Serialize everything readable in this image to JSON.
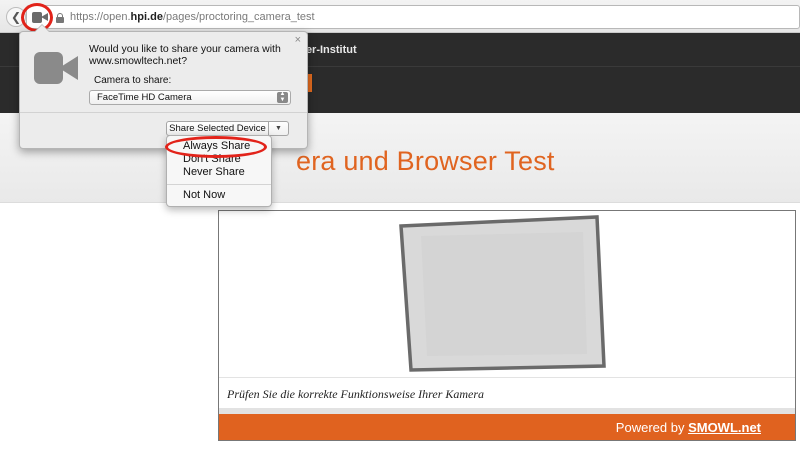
{
  "browser": {
    "back_glyph": "❮",
    "url_prefix": "https://open.",
    "url_domain": "hpi.de",
    "url_path": "/pages/proctoring_camera_test",
    "camera_icon": "camera-icon",
    "lock_icon": "lock-icon"
  },
  "site": {
    "name_fragment": "o-Plattner-Institut",
    "heading_fragment": "era und Browser Test",
    "accent_color": "#e06420"
  },
  "permission_popover": {
    "prompt": "Would you like to share your camera with www.smowltech.net?",
    "camera_label": "Camera to share:",
    "camera_selected": "FaceTime HD Camera",
    "share_button_label": "Share Selected Device",
    "close_glyph": "×",
    "dropdown_glyph": "▼",
    "stepper_up": "▲",
    "stepper_down": "▼"
  },
  "share_menu": {
    "items": [
      "Always Share",
      "Don't Share",
      "Never Share",
      "Not Now"
    ]
  },
  "camera_test": {
    "caption": "Prüfen Sie die korrekte Funktionsweise Ihrer Kamera",
    "powered_text": "Powered by ",
    "powered_link": "SMOWL.net"
  },
  "annotations": {
    "highlight_color": "#e2231a"
  }
}
